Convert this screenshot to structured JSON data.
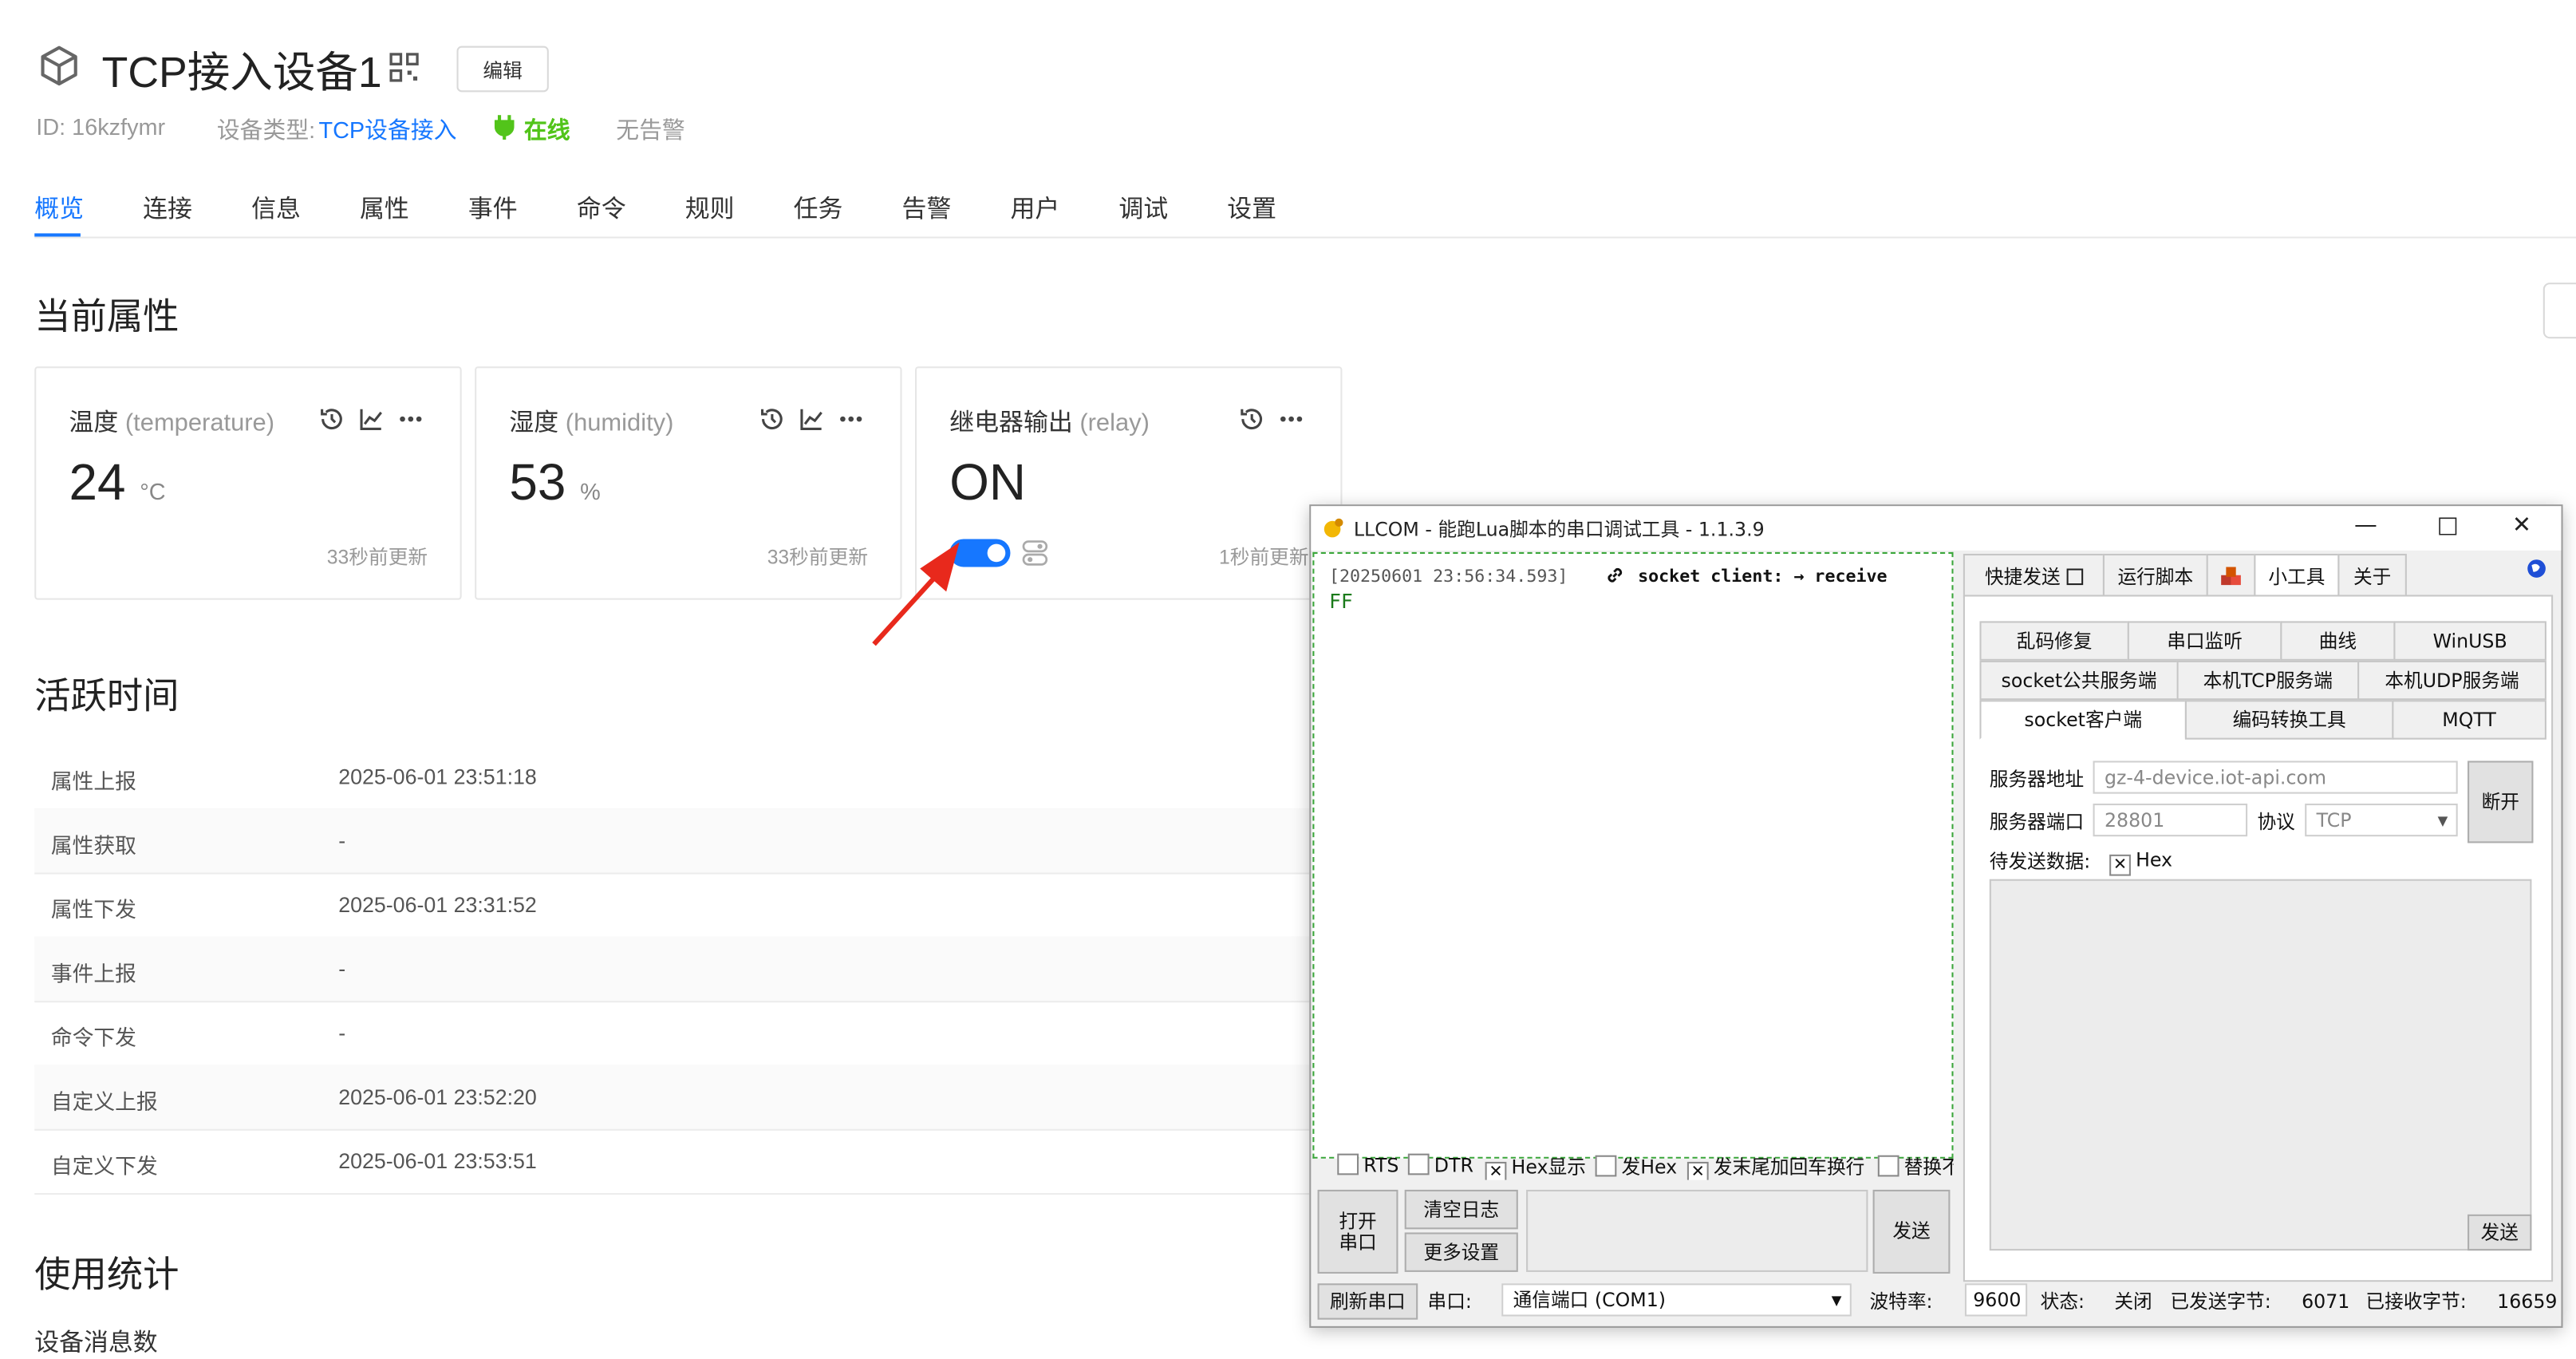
{
  "device": {
    "title": "TCP接入设备1",
    "edit_label": "编辑",
    "id_label": "ID: 16kzfymr",
    "type_label": "设备类型:",
    "type_value": "TCP设备接入",
    "status": "在线",
    "alarm": "无告警"
  },
  "tabs": [
    "概览",
    "连接",
    "信息",
    "属性",
    "事件",
    "命令",
    "规则",
    "任务",
    "告警",
    "用户",
    "调试",
    "设置"
  ],
  "sections": {
    "current_props": "当前属性",
    "active_time": "活跃时间",
    "usage_stats": "使用统计",
    "msg_count": "设备消息数"
  },
  "cards": [
    {
      "title": "温度",
      "key": "(temperature)",
      "value": "24",
      "unit": "°C",
      "updated": "33秒前更新"
    },
    {
      "title": "湿度",
      "key": "(humidity)",
      "value": "53",
      "unit": "%",
      "updated": "33秒前更新"
    },
    {
      "title": "继电器输出",
      "key": "(relay)",
      "value": "ON",
      "unit": "",
      "updated": "1秒前更新"
    }
  ],
  "activity": [
    {
      "label": "属性上报",
      "value": "2025-06-01 23:51:18"
    },
    {
      "label": "属性获取",
      "value": "-"
    },
    {
      "label": "属性下发",
      "value": "2025-06-01 23:31:52"
    },
    {
      "label": "事件上报",
      "value": "-"
    },
    {
      "label": "命令下发",
      "value": "-"
    },
    {
      "label": "自定义上报",
      "value": "2025-06-01 23:52:20"
    },
    {
      "label": "自定义下发",
      "value": "2025-06-01 23:53:51"
    }
  ],
  "llcom": {
    "title": "LLCOM - 能跑Lua脚本的串口调试工具 - 1.1.3.9",
    "log_time": "[20250601 23:56:34.593]",
    "log_msg": "socket client:  → receive",
    "log_data": "FF",
    "checks": {
      "rts": "RTS",
      "dtr": "DTR",
      "hex_show": "Hex显示",
      "send_hex": "发Hex",
      "crlf": "发末尾加回车换行",
      "replace": "替换不"
    },
    "btn_open": "打开串口",
    "btn_open_l1": "打开",
    "btn_open_l2": "串口",
    "btn_clear": "清空日志",
    "btn_more": "更多设置",
    "btn_send": "发送",
    "status": {
      "refresh": "刷新串口",
      "port_label": "串口:",
      "port_value": "通信端口 (COM1)",
      "baud_label": "波特率:",
      "baud_value": "9600",
      "state_label": "状态:",
      "state_value": "关闭",
      "sent_label": "已发送字节:",
      "sent_value": "6071",
      "recv_label": "已接收字节:",
      "recv_value": "16659"
    },
    "top_tabs": [
      "快捷发送",
      "运行脚本",
      "小工具",
      "关于"
    ],
    "tools_row1": [
      "乱码修复",
      "串口监听",
      "曲线",
      "WinUSB"
    ],
    "tools_row2": [
      "socket公共服务端",
      "本机TCP服务端",
      "本机UDP服务端"
    ],
    "tools_row3": [
      "socket客户端",
      "编码转换工具",
      "MQTT"
    ],
    "server_addr_label": "服务器地址",
    "server_addr": "gz-4-device.iot-api.com",
    "server_port_label": "服务器端口",
    "server_port": "28801",
    "protocol_label": "协议",
    "protocol": "TCP",
    "disconnect": "断开",
    "pending_label": "待发送数据:",
    "hex_label": "Hex",
    "send": "发送"
  },
  "colors": {
    "accent": "#1677ff",
    "online": "#52c41a",
    "arrow": "#e8291c"
  }
}
